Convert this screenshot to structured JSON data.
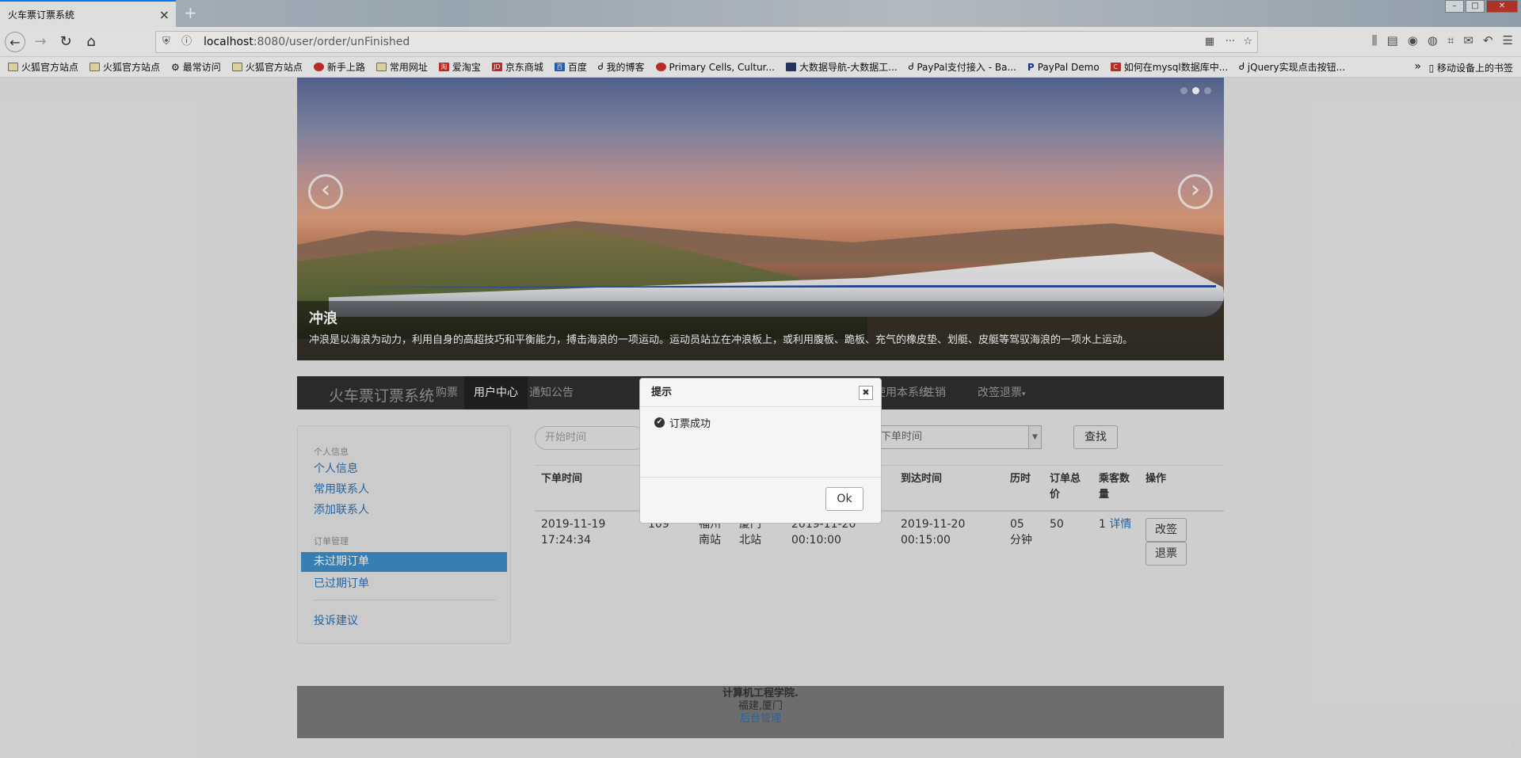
{
  "browser": {
    "tab_title": "火车票订票系统",
    "url_host": "localhost",
    "url_rest": ":8080/user/order/unFinished",
    "bookmarks": [
      "火狐官方站点",
      "火狐官方站点",
      "最常访问",
      "火狐官方站点",
      "新手上路",
      "常用网址",
      "爱淘宝",
      "京东商城",
      "百度",
      "我的博客",
      "Primary Cells, Cultur...",
      "大数据导航-大数据工...",
      "PayPal支付接入 - Ba...",
      "PayPal Demo",
      "如何在mysql数据库中...",
      "jQuery实现点击按钮..."
    ],
    "mobile_bookmarks": "移动设备上的书签"
  },
  "carousel": {
    "caption_title": "冲浪",
    "caption_text": "冲浪是以海浪为动力，利用自身的高超技巧和平衡能力，搏击海浪的一项运动。运动员站立在冲浪板上，或利用腹板、跪板、充气的橡皮垫、划艇、皮艇等驾驭海浪的一项水上运动。"
  },
  "sitenav": {
    "brand": "火车票订票系统",
    "buy": "购票",
    "user_center": "用户中心",
    "notice": "通知公告",
    "welcome": "user您好,欢迎使用本系统",
    "logout": "注销",
    "change_refund": "改签退票"
  },
  "sidebar": {
    "personal_header": "个人信息",
    "personal_info": "个人信息",
    "contacts": "常用联系人",
    "add_contact": "添加联系人",
    "order_header": "订单管理",
    "unexpired": "未过期订单",
    "expired": "已过期订单",
    "complaint": "投诉建议"
  },
  "filters": {
    "start_placeholder": "开始时间",
    "select_value": "下单时间",
    "search_button": "查找"
  },
  "table": {
    "headers": [
      "下单时间",
      "到达时间",
      "历时",
      "订单总价",
      "乘客数量",
      "操作"
    ],
    "row": {
      "order_time": "2019-11-19 17:24:34",
      "train": "109",
      "from": "福州南站",
      "to": "厦门北站",
      "depart": "2019-11-20 00:10:00",
      "arrive": "2019-11-20 00:15:00",
      "duration": "05分钟",
      "price": "50",
      "passengers": "1",
      "details": "详情",
      "change": "改签",
      "refund": "退票"
    }
  },
  "footer": {
    "line1": "计算机工程学院.",
    "line2": "福建,厦门",
    "line3": "后台管理"
  },
  "modal": {
    "title": "提示",
    "message": "订票成功",
    "ok": "Ok"
  },
  "watermark": "CSDN @q_1394918164"
}
